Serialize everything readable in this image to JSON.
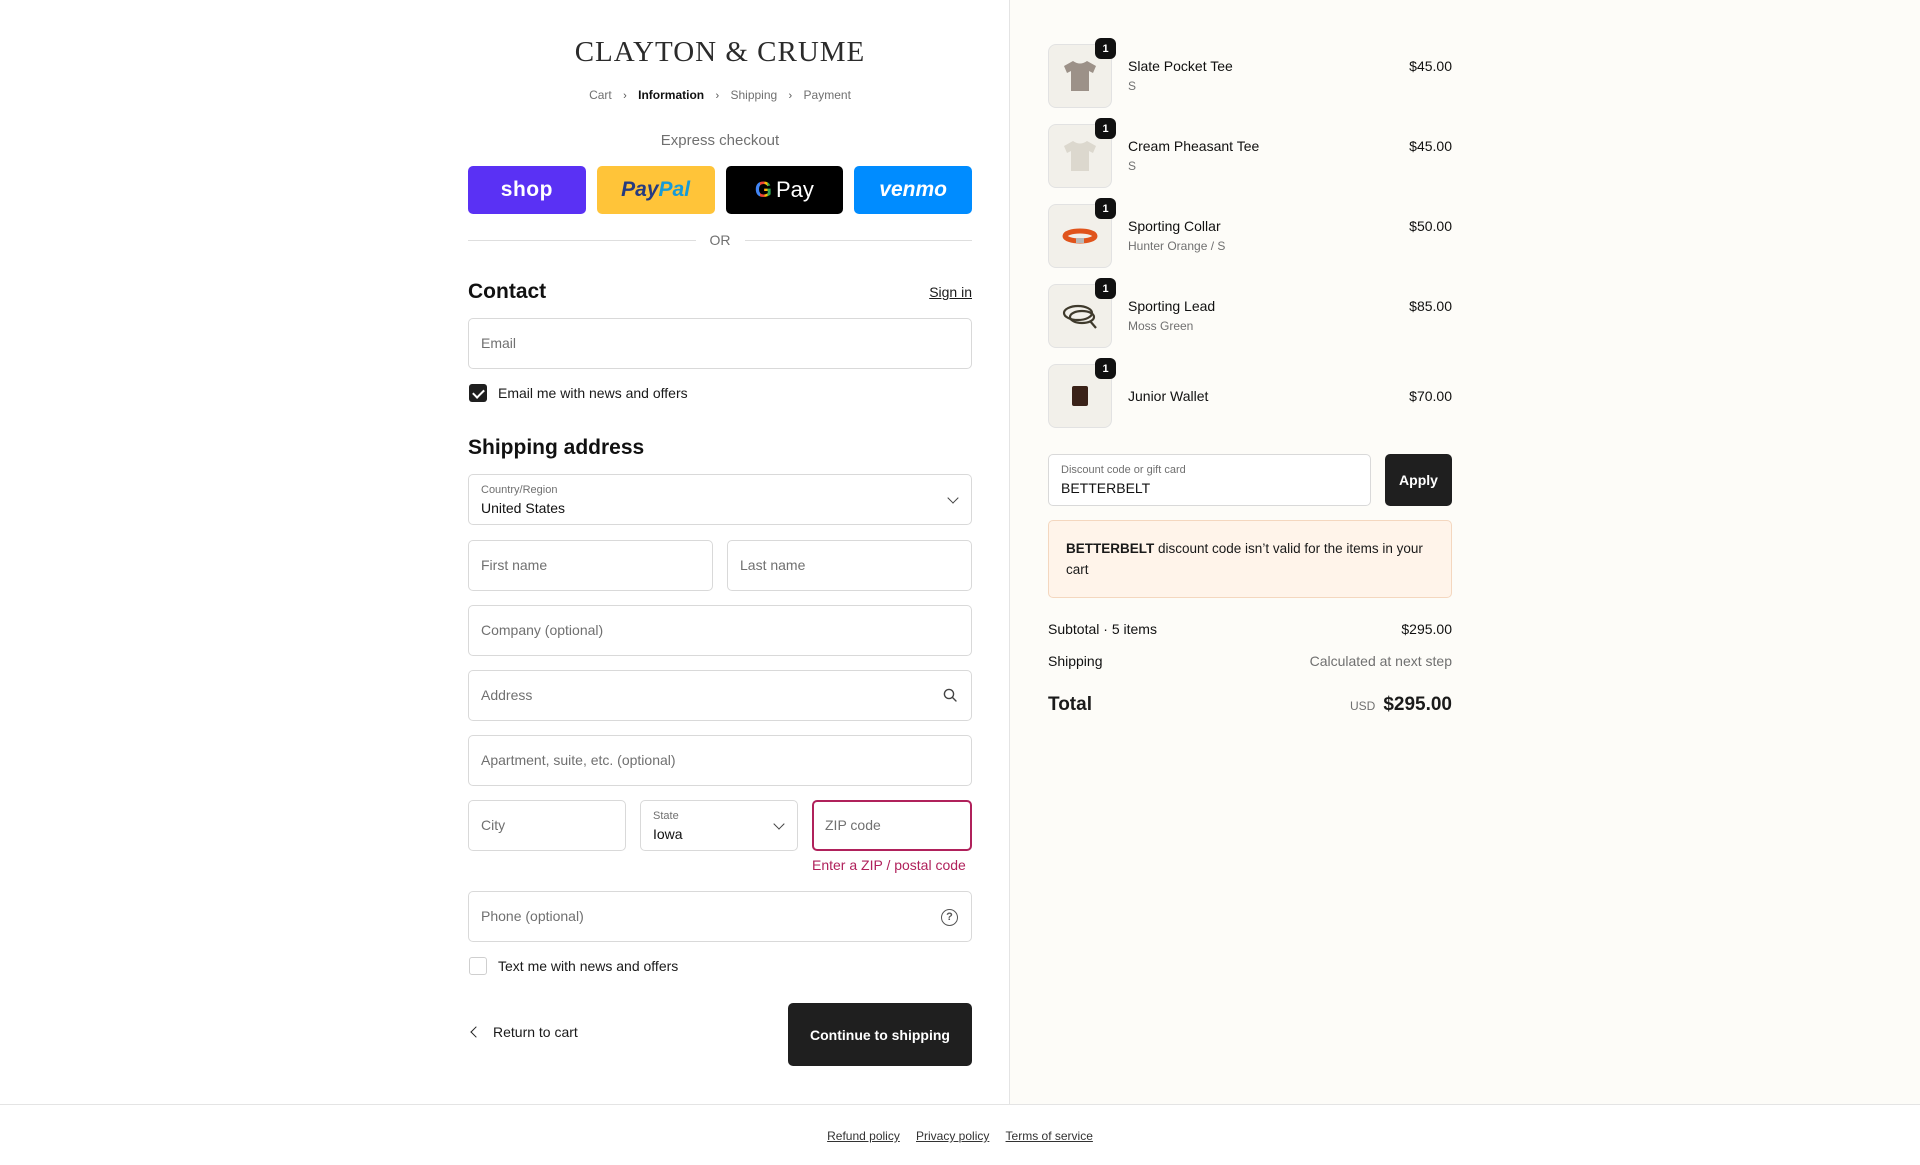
{
  "brand": "CLAYTON & CRUME",
  "breadcrumbs": [
    {
      "label": "Cart",
      "active": false
    },
    {
      "label": "Information",
      "active": true
    },
    {
      "label": "Shipping",
      "active": false
    },
    {
      "label": "Payment",
      "active": false
    }
  ],
  "express": {
    "label": "Express checkout",
    "shop": "shop",
    "paypal_1": "Pay",
    "paypal_2": "Pal",
    "gpay_g": "G",
    "gpay_text": "Pay",
    "venmo": "venmo",
    "or": "OR"
  },
  "contact": {
    "heading": "Contact",
    "sign_in": "Sign in",
    "email_placeholder": "Email",
    "newsletter_label": "Email me with news and offers",
    "newsletter_checked": true
  },
  "shipping": {
    "heading": "Shipping address",
    "country_label": "Country/Region",
    "country_value": "United States",
    "first_name": "First name",
    "last_name": "Last name",
    "company": "Company (optional)",
    "address": "Address",
    "apartment": "Apartment, suite, etc. (optional)",
    "city": "City",
    "state_label": "State",
    "state_value": "Iowa",
    "zip": "ZIP code",
    "zip_error": "Enter a ZIP / postal code",
    "phone": "Phone (optional)",
    "sms_label": "Text me with news and offers",
    "sms_checked": false
  },
  "actions": {
    "return_label": "Return to cart",
    "continue_label": "Continue to shipping"
  },
  "order": {
    "items": [
      {
        "name": "Slate Pocket Tee",
        "variant": "S",
        "price": "$45.00",
        "qty": "1",
        "icon": "tshirt-slate"
      },
      {
        "name": "Cream Pheasant Tee",
        "variant": "S",
        "price": "$45.00",
        "qty": "1",
        "icon": "tshirt-cream"
      },
      {
        "name": "Sporting Collar",
        "variant": "Hunter Orange / S",
        "price": "$50.00",
        "qty": "1",
        "icon": "collar-orange"
      },
      {
        "name": "Sporting Lead",
        "variant": "Moss Green",
        "price": "$85.00",
        "qty": "1",
        "icon": "lead-green"
      },
      {
        "name": "Junior Wallet",
        "variant": "",
        "price": "$70.00",
        "qty": "1",
        "icon": "wallet-brown"
      }
    ],
    "discount_label": "Discount code or gift card",
    "discount_value": "BETTERBELT",
    "apply_label": "Apply",
    "alert_code": "BETTERBELT",
    "alert_text": " discount code isn’t valid for the items in your cart",
    "subtotal_label": "Subtotal · 5 items",
    "subtotal_value": "$295.00",
    "shipping_label": "Shipping",
    "shipping_value": "Calculated at next step",
    "total_label": "Total",
    "total_currency": "USD",
    "total_value": "$295.00"
  },
  "footer": {
    "links": [
      "Refund policy",
      "Privacy policy",
      "Terms of service"
    ]
  },
  "colors": {
    "accent_dark": "#1f1f1f",
    "error": "#b0215b",
    "shop": "#5a31f4",
    "paypal": "#ffc439",
    "venmo": "#008cff",
    "summary_bg": "#fdfcf8",
    "alert_bg": "#fff4ea"
  }
}
